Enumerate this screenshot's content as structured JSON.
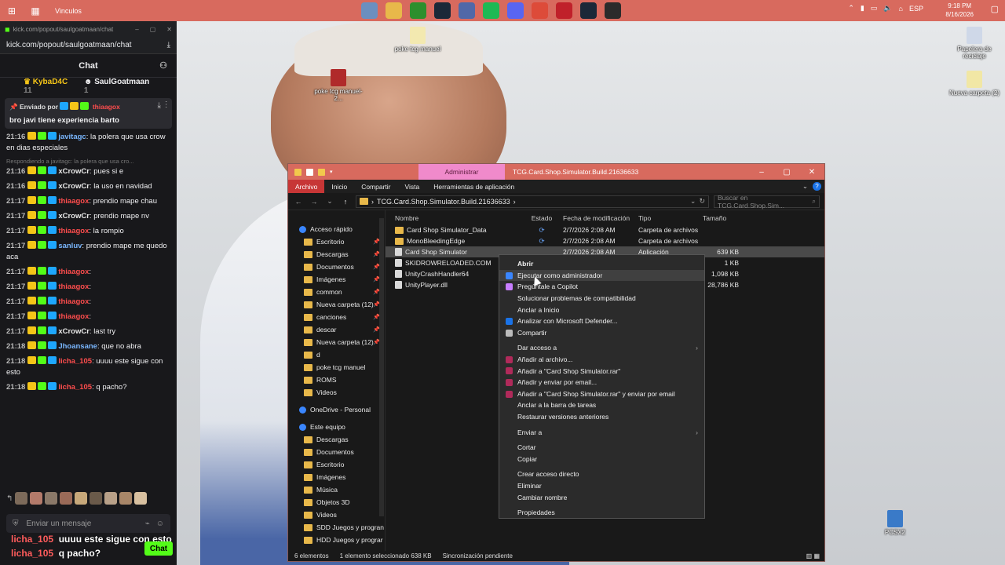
{
  "taskbar": {
    "label": "Vinculos",
    "apps": [
      {
        "icon": "monitor-icon",
        "color": "#6b8fbf"
      },
      {
        "icon": "folder-icon",
        "color": "#e8b84a"
      },
      {
        "icon": "xbox-icon",
        "color": "#2d8f2d"
      },
      {
        "icon": "steam-icon",
        "color": "#1b2838"
      },
      {
        "icon": "network-icon",
        "color": "#5068a8"
      },
      {
        "icon": "spotify-icon",
        "color": "#1db954"
      },
      {
        "icon": "discord-icon",
        "color": "#5865f2"
      },
      {
        "icon": "chrome-icon",
        "color": "#dd4b39"
      },
      {
        "icon": "app-red-icon",
        "color": "#c0202a"
      },
      {
        "icon": "steam-icon",
        "color": "#1b2838"
      },
      {
        "icon": "obs-icon",
        "color": "#2b2b2b"
      }
    ],
    "tray_lang": "ESP",
    "clock_time": "9:18 PM",
    "clock_date": "8/16/2026"
  },
  "chat": {
    "window_title": "kick.com/popout/saulgoatmaan/chat",
    "url": "kick.com/popout/saulgoatmaan/chat",
    "header": "Chat",
    "gifters": [
      {
        "name": "KybaD4C",
        "count": "11"
      },
      {
        "name": "SaulGoatmaan",
        "count": "1"
      }
    ],
    "pinned": {
      "by_label": "Enviado por",
      "by_user": "thiaagox",
      "message": "bro javi tiene experiencia barto"
    },
    "messages": [
      {
        "time": "21:16",
        "user": "javitagc",
        "color": "#7ab7ff",
        "text": "la polera que usa crow en dias especiales"
      },
      {
        "reply": "Respondiendo a javitagc: la polera que usa cro..."
      },
      {
        "time": "21:16",
        "user": "xCrowCr",
        "color": "#e8e8e8",
        "text": "pues si e"
      },
      {
        "time": "21:16",
        "user": "xCrowCr",
        "color": "#e8e8e8",
        "text": "la uso en navidad"
      },
      {
        "time": "21:17",
        "user": "thiaagox",
        "color": "#ff4d4d",
        "text": "prendio mape chau"
      },
      {
        "time": "21:17",
        "user": "xCrowCr",
        "color": "#e8e8e8",
        "text": "prendio mape nv"
      },
      {
        "time": "21:17",
        "user": "thiaagox",
        "color": "#ff4d4d",
        "text": "la rompio"
      },
      {
        "time": "21:17",
        "user": "sanluv",
        "color": "#7ab7ff",
        "text": "prendio mape me quedo aca"
      },
      {
        "time": "21:17",
        "user": "thiaagox",
        "color": "#ff4d4d",
        "text": ""
      },
      {
        "time": "21:17",
        "user": "thiaagox",
        "color": "#ff4d4d",
        "text": ""
      },
      {
        "time": "21:17",
        "user": "thiaagox",
        "color": "#ff4d4d",
        "text": ""
      },
      {
        "time": "21:17",
        "user": "thiaagox",
        "color": "#ff4d4d",
        "text": ""
      },
      {
        "time": "21:17",
        "user": "xCrowCr",
        "color": "#e8e8e8",
        "text": "last try"
      },
      {
        "time": "21:18",
        "user": "Jhoansane",
        "color": "#7ab7ff",
        "text": "que no abra"
      },
      {
        "time": "21:18",
        "user": "licha_105",
        "color": "#ff4d4d",
        "text": "uuuu este sigue con esto"
      },
      {
        "time": "21:18",
        "user": "licha_105",
        "color": "#ff4d4d",
        "text": "q pacho?"
      }
    ],
    "input_placeholder": "Enviar un mensaje",
    "chat_button": "Chat",
    "overlay": [
      {
        "user": "licha_105",
        "text": "uuuu este sigue con esto"
      },
      {
        "user": "licha_105",
        "text": "q pacho?"
      }
    ]
  },
  "desktop_icons": [
    {
      "label": "poke tcg manuel",
      "color": "#f3e9b0"
    },
    {
      "label": "poke tcg manuel-2...",
      "color": "#b02a2a"
    },
    {
      "label": "Papelera de reciclaje",
      "color": "#cfd8e8"
    },
    {
      "label": "Nueva carpeta (2)",
      "color": "#f1e7a5"
    },
    {
      "label": "PCSX2",
      "color": "#3a7ac8"
    }
  ],
  "explorer": {
    "manage_label": "Administrar",
    "title": "TCG.Card.Shop.Simulator.Build.21636633",
    "ribbon_tabs": [
      "Archivo",
      "Inicio",
      "Compartir",
      "Vista",
      "Herramientas de aplicación"
    ],
    "path": "TCG.Card.Shop.Simulator.Build.21636633",
    "search_placeholder": "Buscar en TCG.Card.Shop.Sim...",
    "nav": [
      {
        "label": "Acceso rápido",
        "head": true
      },
      {
        "label": "Escritorio",
        "pinned": true
      },
      {
        "label": "Descargas",
        "pinned": true
      },
      {
        "label": "Documentos",
        "pinned": true
      },
      {
        "label": "Imágenes",
        "pinned": true
      },
      {
        "label": "common",
        "pinned": true
      },
      {
        "label": "Nueva carpeta (12)",
        "pinned": true
      },
      {
        "label": "canciones",
        "pinned": true
      },
      {
        "label": "descar",
        "pinned": true
      },
      {
        "label": "Nueva carpeta (12)",
        "pinned": true
      },
      {
        "label": "d",
        "pinned": false
      },
      {
        "label": "poke tcg manuel",
        "pinned": false
      },
      {
        "label": "ROMS",
        "pinned": false
      },
      {
        "label": "Videos",
        "pinned": false
      },
      {
        "label": "OneDrive - Personal",
        "head": true
      },
      {
        "label": "Este equipo",
        "head": true
      },
      {
        "label": "Descargas",
        "pinned": false
      },
      {
        "label": "Documentos",
        "pinned": false
      },
      {
        "label": "Escritorio",
        "pinned": false
      },
      {
        "label": "Imágenes",
        "pinned": false
      },
      {
        "label": "Música",
        "pinned": false
      },
      {
        "label": "Objetos 3D",
        "pinned": false
      },
      {
        "label": "Videos",
        "pinned": false
      },
      {
        "label": "SDD Juegos y progran",
        "pinned": false
      },
      {
        "label": "HDD Juegos y prograr",
        "pinned": false
      }
    ],
    "columns": [
      "Nombre",
      "Estado",
      "Fecha de modificación",
      "Tipo",
      "Tamaño"
    ],
    "files": [
      {
        "name": "Card Shop Simulator_Data",
        "state": "⟳",
        "date": "2/7/2026 2:08 AM",
        "type": "Carpeta de archivos",
        "size": "",
        "kind": "folder"
      },
      {
        "name": "MonoBleedingEdge",
        "state": "⟳",
        "date": "2/7/2026 2:08 AM",
        "type": "Carpeta de archivos",
        "size": "",
        "kind": "folder"
      },
      {
        "name": "Card Shop Simulator",
        "state": "",
        "date": "2/7/2026 2:08 AM",
        "type": "Aplicación",
        "size": "639 KB",
        "kind": "exe",
        "selected": true
      },
      {
        "name": "SKIDROWRELOADED.COM",
        "state": "",
        "date": "",
        "type": "",
        "size": "1 KB",
        "kind": "file"
      },
      {
        "name": "UnityCrashHandler64",
        "state": "",
        "date": "",
        "type": "",
        "size": "1,098 KB",
        "kind": "exe"
      },
      {
        "name": "UnityPlayer.dll",
        "state": "",
        "date": "",
        "type": "",
        "size": "28,786 KB",
        "kind": "file"
      }
    ],
    "status": [
      "6 elementos",
      "1 elemento seleccionado  638 KB",
      "Sincronización pendiente"
    ]
  },
  "context_menu": [
    {
      "label": "Abrir",
      "bold": true
    },
    {
      "label": "Ejecutar como administrador",
      "icon": "shield-icon",
      "icon_color": "#3a86ff",
      "hover": true
    },
    {
      "label": "Pregúntale a Copilot",
      "icon": "copilot-icon",
      "icon_color": "#c77dff"
    },
    {
      "label": "Solucionar problemas de compatibilidad"
    },
    {
      "label": "Anclar a Inicio"
    },
    {
      "label": "Analizar con Microsoft Defender...",
      "icon": "defender-icon",
      "icon_color": "#1a73e8"
    },
    {
      "label": "Compartir",
      "icon": "share-icon",
      "icon_color": "#bbbbbb"
    },
    {
      "sep": true
    },
    {
      "label": "Dar acceso a",
      "submenu": true
    },
    {
      "label": "Añadir al archivo...",
      "icon": "winrar-icon",
      "icon_color": "#b02a5a"
    },
    {
      "label": "Añadir a \"Card Shop Simulator.rar\"",
      "icon": "winrar-icon",
      "icon_color": "#b02a5a"
    },
    {
      "label": "Añadir y enviar por email...",
      "icon": "winrar-icon",
      "icon_color": "#b02a5a"
    },
    {
      "label": "Añadir a \"Card Shop Simulator.rar\" y enviar por email",
      "icon": "winrar-icon",
      "icon_color": "#b02a5a"
    },
    {
      "label": "Anclar a la barra de tareas"
    },
    {
      "label": "Restaurar versiones anteriores"
    },
    {
      "sep": true
    },
    {
      "label": "Enviar a",
      "submenu": true
    },
    {
      "sep": true
    },
    {
      "label": "Cortar"
    },
    {
      "label": "Copiar"
    },
    {
      "sep": true
    },
    {
      "label": "Crear acceso directo"
    },
    {
      "label": "Eliminar"
    },
    {
      "label": "Cambiar nombre"
    },
    {
      "sep": true
    },
    {
      "label": "Propiedades"
    }
  ]
}
